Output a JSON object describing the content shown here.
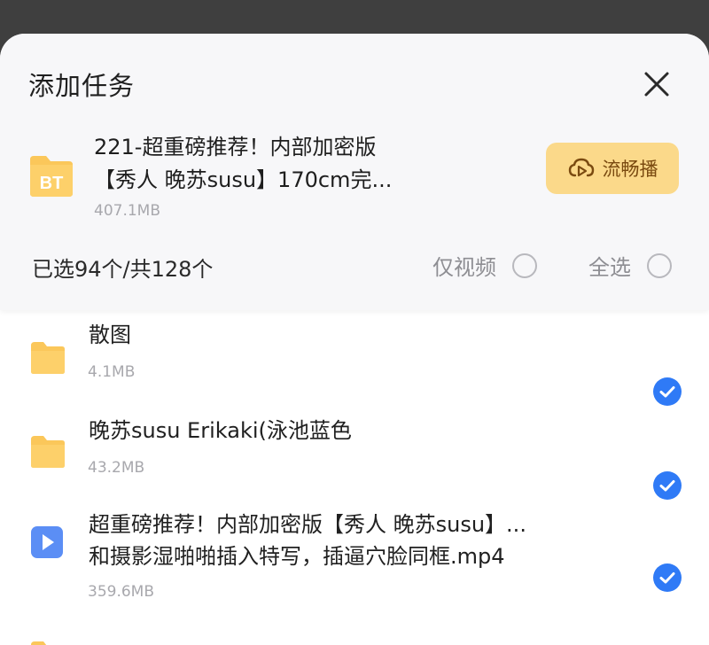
{
  "dialog": {
    "title": "添加任务",
    "close_icon": "close-icon"
  },
  "torrent": {
    "badge": "BT",
    "name_line1": "221-超重磅推荐！内部加密版",
    "name_line2": "【秀人 晚苏susu】170cm完...",
    "size": "407.1MB",
    "stream_label": "流畅播",
    "stream_icon": "cloud-play-icon"
  },
  "selection": {
    "count_text": "已选94个/共128个",
    "video_only_label": "仅视频",
    "select_all_label": "全选"
  },
  "files": [
    {
      "type": "folder",
      "name_line1": "散图",
      "name_line2": "",
      "size": "4.1MB",
      "checked": true
    },
    {
      "type": "folder",
      "name_line1": "晚苏susu Erikaki(泳池蓝色",
      "name_line2": "",
      "size": "43.2MB",
      "checked": true
    },
    {
      "type": "video",
      "name_line1": "超重磅推荐！内部加密版【秀人 晚苏susu】...",
      "name_line2": "和摄影湿啪啪插入特写，插逼穴脸同框.mp4",
      "size": "359.6MB",
      "checked": true
    },
    {
      "type": "folder",
      "name_line1": "",
      "name_line2": "",
      "size": "",
      "checked": false
    }
  ],
  "colors": {
    "accent": "#2f7af6",
    "folder": "#fbc75a",
    "stream_button": "#fbd98a",
    "stream_text": "#7a4a10"
  }
}
